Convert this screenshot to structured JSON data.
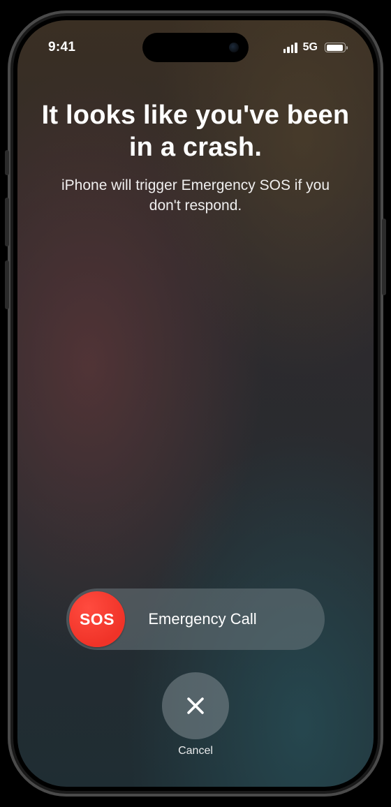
{
  "status": {
    "time": "9:41",
    "network": "5G"
  },
  "heading": {
    "title": "It looks like you've been in a crash.",
    "subtitle": "iPhone will trigger Emergency SOS if you don't respond."
  },
  "slider": {
    "knob_text": "SOS",
    "label": "Emergency Call"
  },
  "cancel": {
    "label": "Cancel"
  }
}
